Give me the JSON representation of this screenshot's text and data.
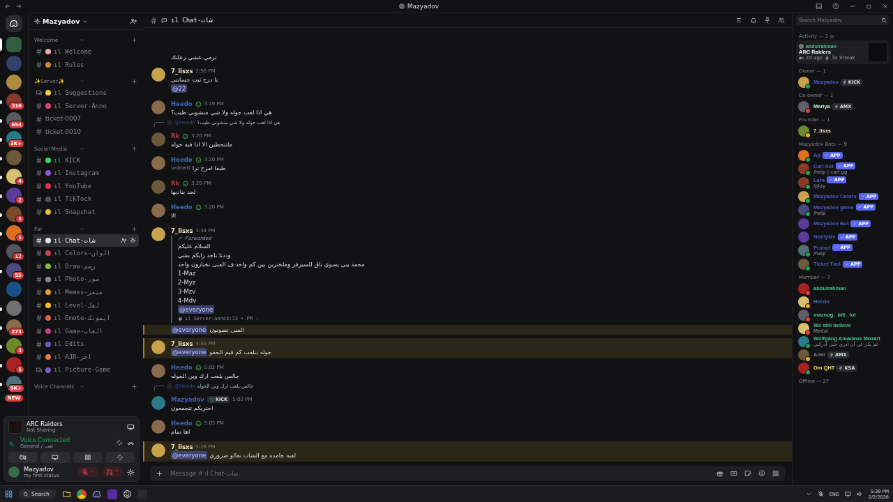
{
  "window": {
    "title": "Mazyadov"
  },
  "servers": [
    {
      "selected": true,
      "unread": false
    },
    {
      "selected": false,
      "unread": false
    },
    {
      "selected": false,
      "unread": false
    },
    {
      "badge": "316",
      "selected": false,
      "unread": true
    },
    {
      "badge": "654",
      "selected": false,
      "unread": true
    },
    {
      "badge": "3K+",
      "selected": false,
      "unread": true
    },
    {
      "selected": false,
      "unread": true
    },
    {
      "badge": "4",
      "selected": false,
      "unread": true
    },
    {
      "badge": "2",
      "selected": false,
      "unread": true
    },
    {
      "badge": "1",
      "selected": false,
      "unread": true
    },
    {
      "badge": "1",
      "selected": false,
      "unread": true
    },
    {
      "badge": "12",
      "selected": false,
      "unread": false
    },
    {
      "badge": "55",
      "selected": false,
      "unread": true
    },
    {
      "selected": false,
      "unread": false
    },
    {
      "selected": false,
      "unread": true
    },
    {
      "badge": "273",
      "selected": false,
      "unread": true
    },
    {
      "badge": "3",
      "selected": false,
      "unread": true
    },
    {
      "badge": "1",
      "selected": false,
      "unread": true
    },
    {
      "badge": "9K+",
      "selected": false,
      "unread": true
    }
  ],
  "new_pill": "NEW",
  "server_header": {
    "name": "Mazyadov"
  },
  "channel_groups": [
    {
      "name": "Welcome",
      "channels": [
        {
          "name": "ıl Welcome",
          "kind": "text",
          "color": "#f0a8b0",
          "selected": false
        },
        {
          "name": "ıl Rules",
          "kind": "text",
          "color": "#c88a40",
          "selected": false
        }
      ]
    },
    {
      "name": "✨Server✨",
      "channels": [
        {
          "name": "ıl Suggestions",
          "kind": "forum",
          "color": "#f0d040",
          "selected": false
        },
        {
          "name": "ıl Server-Anno",
          "kind": "text",
          "color": "#e04070",
          "selected": false
        },
        {
          "name": "ticket-0007",
          "kind": "ticket",
          "selected": false
        },
        {
          "name": "ticket-0010",
          "kind": "ticket",
          "selected": false
        }
      ]
    },
    {
      "name": "Social Media",
      "channels": [
        {
          "name": "ıl KICK",
          "kind": "text",
          "color": "#3ad36a",
          "selected": false
        },
        {
          "name": "ıl Instagram",
          "kind": "text",
          "color": "#8a5ad8",
          "selected": false
        },
        {
          "name": "ıl YouTube",
          "kind": "text",
          "color": "#e0305a",
          "selected": false
        },
        {
          "name": "ıl TikTock",
          "kind": "text",
          "color": "#555560",
          "selected": false
        },
        {
          "name": "ıl Snapchat",
          "kind": "text",
          "color": "#e8c030",
          "selected": false
        }
      ]
    },
    {
      "name": "For",
      "channels": [
        {
          "name": "ıl Chat-شات",
          "kind": "text",
          "color": "#e8e8e8",
          "selected": true
        },
        {
          "name": "ıl Colors-الوان",
          "kind": "text",
          "color": "#d04050",
          "selected": false
        },
        {
          "name": "ıl Draw-رسم",
          "kind": "text",
          "color": "#80c040",
          "selected": false
        },
        {
          "name": "ıl Photo-صور",
          "kind": "text",
          "color": "#8a8a90",
          "selected": false
        },
        {
          "name": "ıl Memes-ميمز",
          "kind": "text",
          "color": "#e0a030",
          "selected": false
        },
        {
          "name": "ıl Level-لفل",
          "kind": "text",
          "color": "#f0c020",
          "selected": false
        },
        {
          "name": "ıl Emote-ايموتك",
          "kind": "text",
          "color": "#e06040",
          "selected": false
        },
        {
          "name": "ıl Game-العاب",
          "kind": "text",
          "color": "#c04080",
          "selected": false
        },
        {
          "name": "ıl Edits",
          "kind": "text",
          "color": "#6a5ad0",
          "selected": false
        },
        {
          "name": "ıl AJR-اجر",
          "kind": "text",
          "color": "#e08040",
          "selected": false
        },
        {
          "name": "ıl Picture-Game",
          "kind": "forum",
          "color": "#7a5ad0",
          "selected": false
        }
      ]
    },
    {
      "name": "Voice Channels"
    }
  ],
  "activity_panel": {
    "game": "ARC Raiders",
    "status": "Not Sharing"
  },
  "voice_panel": {
    "title": "Voice Connected",
    "channel": "General / لعب"
  },
  "user_panel": {
    "name": "Mazyadov",
    "status": "my first status"
  },
  "channel_header": {
    "name": "ıl Chat-شات"
  },
  "messages": [
    {
      "kind": "continuation",
      "highlighted": false,
      "lines": [
        {
          "text": "ترمي عشي زعلتك"
        }
      ]
    },
    {
      "kind": "message",
      "author": "7_lisxs",
      "color": "#f0e6c0",
      "role_icon": false,
      "time": "2:56 PM",
      "highlighted": false,
      "lines": [
        {
          "text": "يا درج ثبت حسابتي"
        },
        {
          "mention": "@22"
        }
      ]
    },
    {
      "kind": "message",
      "author": "Heedo",
      "color": "#3a6ab0",
      "role_icon": true,
      "time": "3:19 PM",
      "highlighted": false,
      "lines": [
        {
          "text": "هي اذا لعب جوله ولا شي منشوني طيب؟"
        }
      ]
    },
    {
      "kind": "message",
      "author": "Rk",
      "color": "#b03a3a",
      "role_icon": true,
      "time": "3:20 PM",
      "highlighted": false,
      "reply": {
        "author": "@Heedo",
        "text": "هي اذا لعب جوله ولا شي منشوني طيب؟"
      },
      "lines": [
        {
          "text": "ماتتحطين الا اذا فيه جوله"
        }
      ]
    },
    {
      "kind": "message",
      "author": "Heedo",
      "color": "#3a6ab0",
      "role_icon": true,
      "time": "3:20 PM",
      "highlighted": false,
      "lines": [
        {
          "text": "طبعا امزح ترا",
          "edited": "(edited)"
        }
      ]
    },
    {
      "kind": "message",
      "author": "Rk",
      "color": "#b03a3a",
      "role_icon": true,
      "time": "3:20 PM",
      "highlighted": false,
      "lines": [
        {
          "text": "لحد يناديها"
        }
      ]
    },
    {
      "kind": "message",
      "author": "Heedo",
      "color": "#3a6ab0",
      "role_icon": true,
      "time": "3:20 PM",
      "highlighted": false,
      "lines": [
        {
          "text": "الا"
        }
      ]
    },
    {
      "kind": "message",
      "author": "7_lisxs",
      "color": "#f0e6c0",
      "role_icon": false,
      "time": "3:34 PM",
      "highlighted": false,
      "forwarded": {
        "label": "Forwarded",
        "lines": [
          "السلام عليكم",
          "وددنا ناخذ رايكم بشي",
          "محمد يبي يسوي تاق للسيرفر وملخترين بين كم واحد ف المنى تختارون واحد",
          "1-Maz",
          "2-Myz",
          "3-Mzv",
          "4-Mdv"
        ],
        "mention": "@everyone",
        "source": "ıl Server-Anno3:33 • PM ›"
      }
    },
    {
      "kind": "continuation",
      "highlighted": true,
      "lines": [
        {
          "mention": "@everyone",
          "text": "المنى تصوتون"
        }
      ]
    },
    {
      "kind": "message",
      "author": "7_lisxs",
      "color": "#f0e6c0",
      "role_icon": false,
      "time": "4:55 PM",
      "highlighted": true,
      "lines": [
        {
          "mention": "@everyone",
          "text": "جوله بنلعب كم قيم الحقو"
        }
      ]
    },
    {
      "kind": "message",
      "author": "Heedo",
      "color": "#3a6ab0",
      "role_icon": true,
      "time": "5:02 PM",
      "highlighted": false,
      "lines": [
        {
          "text": "جالس يلعب ارك وين الجوله"
        }
      ]
    },
    {
      "kind": "message",
      "author": "Mazyadov",
      "color": "#4a5ac0",
      "role_icon": false,
      "tag": "KICK",
      "time": "5:02 PM",
      "highlighted": false,
      "reply": {
        "author": "@Heedo",
        "text": "جالس يلعب ارك وين الجوله"
      },
      "lines": [
        {
          "text": "احتريكم تتجمعون"
        }
      ]
    },
    {
      "kind": "message",
      "author": "Heedo",
      "color": "#3a6ab0",
      "role_icon": true,
      "time": "5:03 PM",
      "highlighted": false,
      "lines": [
        {
          "text": "اها تمام"
        }
      ]
    },
    {
      "kind": "message",
      "author": "7_lisxs",
      "color": "#f0e6c0",
      "role_icon": false,
      "time": "5:28 PM",
      "highlighted": true,
      "lines": [
        {
          "mention": "@everyone",
          "text": "لعبه جامده مع الشات تعالو ضروري"
        }
      ]
    }
  ],
  "composer": {
    "placeholder": "Message # ıl Chat-شات"
  },
  "member_search": {
    "placeholder": "Search Mazyadov"
  },
  "activity": {
    "title": "Activity — 1",
    "user": "abdulrahman",
    "game": "ARC Raiders",
    "ago": "2d ago",
    "streak": "3x Streak"
  },
  "member_sections": [
    {
      "title": "Owner — 1",
      "members": [
        {
          "name": "Mazyadov",
          "color": "#4a5ac0",
          "status_dot": {
            "color": "#23a55a"
          },
          "tag": {
            "kind": "role",
            "label": "KICK"
          }
        }
      ]
    },
    {
      "title": "Co-owner — 1",
      "members": [
        {
          "name": "Mariya",
          "color": "#b8f0c8",
          "status_dot": {
            "color": "#f23f43"
          },
          "tag": {
            "kind": "role",
            "label": "AMX"
          }
        }
      ]
    },
    {
      "title": "Founder — 1",
      "members": [
        {
          "name": "7_lisxs",
          "color": "#f0e6c0",
          "status_dot": {
            "color": "#f0b232"
          }
        }
      ]
    },
    {
      "title": "Mazyadov Bots — 9",
      "members": [
        {
          "name": "Ap",
          "color": "#4a5ac0",
          "status_dot": {
            "color": "#23a55a"
          },
          "tag": {
            "kind": "app",
            "label": "APP"
          }
        },
        {
          "name": "Carl-bot",
          "color": "#4a5ac0",
          "status_dot": {
            "color": "#23a55a"
          },
          "tag": {
            "kind": "app",
            "label": "APP"
          },
          "sub": "/help | carl.gg"
        },
        {
          "name": "Lara",
          "color": "#4a5ac0",
          "status_dot": {
            "color": "#23a55a"
          },
          "tag": {
            "kind": "app",
            "label": "APP"
          },
          "sub": "/play"
        },
        {
          "name": "Mazyadov Colors",
          "color": "#4a5ac0",
          "status_dot": {
            "color": "#23a55a"
          },
          "tag": {
            "kind": "app",
            "label": "APP"
          }
        },
        {
          "name": "Mazyadov game",
          "color": "#4a5ac0",
          "status_dot": {
            "color": "#23a55a"
          },
          "tag": {
            "kind": "app",
            "label": "APP"
          },
          "sub": "/help"
        },
        {
          "name": "Mazyadov Bot",
          "color": "#4a5ac0",
          "tag": {
            "kind": "app",
            "label": "APP"
          }
        },
        {
          "name": "NotifyMe",
          "color": "#4a5ac0",
          "tag": {
            "kind": "app",
            "label": "APP"
          }
        },
        {
          "name": "Probot",
          "color": "#4a5ac0",
          "status_dot": {
            "color": "#23a55a"
          },
          "tag": {
            "kind": "app",
            "label": "APP"
          },
          "sub": "/help"
        },
        {
          "name": "Ticket Tool",
          "color": "#4a5ac0",
          "status_dot": {
            "color": "#23a55a"
          },
          "tag": {
            "kind": "app",
            "label": "APP"
          }
        }
      ]
    },
    {
      "title": "Member — 7",
      "members": [
        {
          "name": "abdulrahman",
          "color": "#4ac08a",
          "status_dot": {
            "color": "#f23f43"
          }
        },
        {
          "name": "Heedo",
          "color": "#3a6ab0",
          "status_dot": {
            "color": "#f0b232"
          }
        },
        {
          "name": "maznog_ bill_ lot",
          "color": "#4ac08a",
          "status_dot": {
            "color": "#f23f43"
          }
        },
        {
          "name": "We still believe",
          "color": "#4ac08a",
          "status_dot": {
            "color": "#f23f43"
          },
          "sub": "Medal"
        },
        {
          "name": "Wolfgang Amadeus Mozart",
          "color": "#4ac08a",
          "status_dot": {
            "color": "#23a55a"
          },
          "sub": "لم يكن لي أن أدري حتى أدركني"
        },
        {
          "name": "Amir",
          "color": "#808088",
          "status_dot": {
            "color": "#f0b232"
          },
          "tag": {
            "kind": "role",
            "label": "AMX"
          }
        },
        {
          "name": "Om QHT",
          "color": "#f0e070",
          "status_dot": {
            "color": "#23a55a"
          },
          "tag": {
            "kind": "role",
            "label": "KSA"
          }
        }
      ]
    },
    {
      "title": "Offline — 27"
    }
  ],
  "taskbar": {
    "search": "Search",
    "language": "ENG",
    "time": "5:39 PM",
    "date": "2/2/2026"
  }
}
